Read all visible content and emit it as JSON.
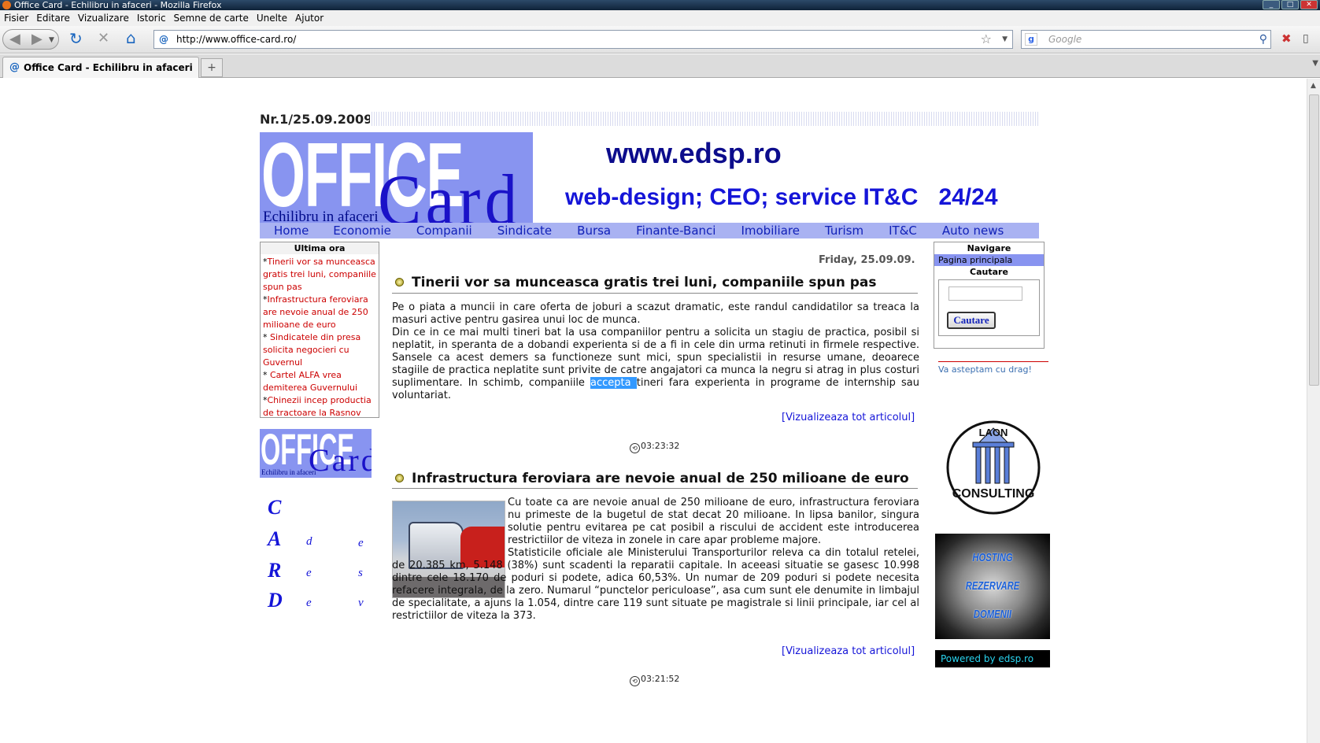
{
  "window": {
    "title": "Office Card - Echilibru in afaceri - Mozilla Firefox"
  },
  "menu": [
    "Fisier",
    "Editare",
    "Vizualizare",
    "Istoric",
    "Semne de carte",
    "Unelte",
    "Ajutor"
  ],
  "address": {
    "url": "http://www.office-card.ro/"
  },
  "search": {
    "placeholder": "Google"
  },
  "tab": {
    "title": "Office Card - Echilibru in afaceri"
  },
  "page": {
    "issue": "Nr.1/25.09.2009",
    "logo": {
      "office": "OFFICE",
      "card": "Card",
      "tagline": "Echilibru in afaceri"
    },
    "banner": {
      "site": "www.edsp.ro",
      "services": "web-design; CEO; service IT&C",
      "hours": "24/24"
    },
    "nav": [
      "Home",
      "Economie",
      "Companii",
      "Sindicate",
      "Bursa",
      "Finante-Banci",
      "Imobiliare",
      "Turism",
      "IT&C",
      "Auto news"
    ],
    "ultima_ora": {
      "title": "Ultima ora",
      "items": [
        "Tinerii vor sa munceasca gratis trei luni, companiile spun pas",
        "Infrastructura feroviara are nevoie anual de 250 milioane de euro",
        " Sindicatele din presa solicita negocieri cu Guvernul",
        " Cartel ALFA vrea demiterea Guvernului",
        "Chinezii incep productia de tractoare la Rasnov"
      ]
    },
    "card_letters": {
      "c": "C",
      "a": "A",
      "r": "R",
      "d": "D",
      "c2": "d",
      "c3": "e",
      "c4": "e",
      "c5": "s",
      "c6": "e",
      "c7": "v"
    },
    "date": "Friday, 25.09.09.",
    "articles": [
      {
        "title": "Tinerii vor sa munceasca gratis trei luni, companiile spun pas",
        "p1": "Pe o piata a muncii in care oferta de joburi a scazut dramatic, este randul candidatilor sa treaca la masuri active pentru gasirea unui loc de munca.",
        "p2a": "Din ce in ce mai multi tineri bat la usa companiilor pentru a solicita un stagiu de practica, posibil si neplatit, in speranta de a dobandi experienta si de a fi in cele din urma retinuti in firmele respective. Sansele ca acest demers sa functioneze sunt mici, spun specialistii in resurse umane, deoarece stagiile de practica neplatite sunt privite de catre angajatori ca munca la negru si atrag in plus costuri suplimentare. In schimb, companiile ",
        "highlight": "accepta ",
        "p2b": "tineri fara experienta in programe de internship sau voluntariat.",
        "more": "[Vizualizeaza tot articolul]",
        "time": "03:23:32"
      },
      {
        "title": "Infrastructura feroviara are nevoie anual de 250 milioane de euro",
        "p1": "Cu toate ca are nevoie anual de 250 milioane de euro, infrastructura feroviara nu primeste de la bugetul de stat decat 20 milioane. In lipsa banilor, singura solutie pentru evitarea pe cat posibil a riscului de accident este introducerea restrictiilor de viteza in zonele in care apar probleme majore.",
        "p2": "Statisticile oficiale ale Ministerului Transporturilor releva ca din totalul retelei, de 20.385 km, 5.148 (38%) sunt scadenti la reparatii capitale. In aceeasi situatie se gasesc 10.998 dintre cele 18.170 de poduri si podete, adica 60,53%. Un numar de 209 poduri si podete necesita refacere integrala, de la zero. Numarul “punctelor periculoase”, asa cum sunt ele denumite in limbajul de specialitate, a ajuns la 1.054, dintre care 119 sunt situate pe magistrale si linii principale, iar cel al restrictiilor de viteza la 373.",
        "more": "[Vizualizeaza tot articolul]",
        "time": "03:21:52"
      }
    ],
    "sidebar": {
      "nav_title": "Navigare",
      "nav_item": "Pagina principala",
      "search_title": "Cautare",
      "search_button": "Cautare",
      "welcome": "Va asteptam cu drag!",
      "laon_top": "LAON",
      "laon_bottom": "CONSULTING",
      "hosting": [
        "HOSTING",
        "REZERVARE",
        "DOMENII"
      ],
      "powered": "Powered by edsp.ro"
    }
  },
  "colors": {
    "logo_bg": "#8894f0",
    "nav_bg": "#a9b2f2",
    "link_red": "#cc0000",
    "link_blue": "#1515d8"
  }
}
